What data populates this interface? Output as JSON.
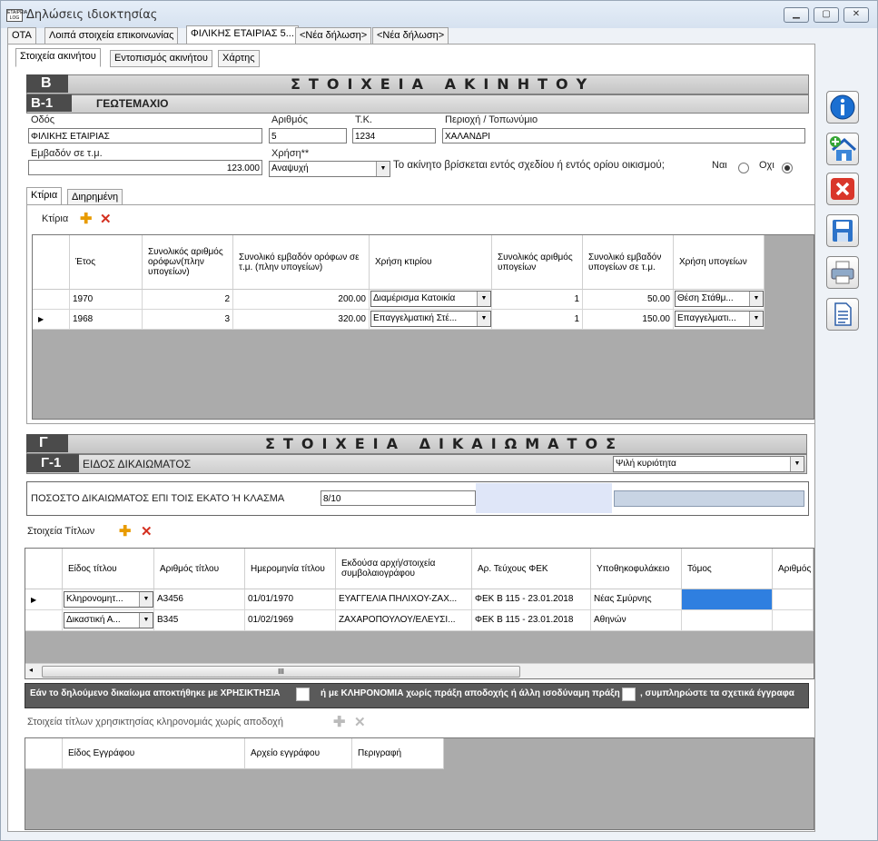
{
  "window": {
    "title": "Δηλώσεις ιδιοκτησίας",
    "app_icon": "ΕΤΑΙΡΕΙΑ LOG"
  },
  "main_tabs": [
    "ΟΤΑ",
    "Λοιπά στοιχεία επικοινωνίας",
    "ΦΙΛΙΚΗΣ ΕΤΑΙΡΙΑΣ 5...",
    "<Νέα δήλωση>",
    "<Νέα δήλωση>"
  ],
  "sub_tabs": [
    "Στοιχεία ακινήτου",
    "Εντοπισμός ακινήτου",
    "Χάρτης"
  ],
  "section_b": {
    "letter": "Β",
    "title": "ΣΤΟΙΧΕΙΑ ΑΚΙΝΗΤΟΥ",
    "sub_code": "Β-1",
    "sub_title": "ΓΕΩΤΕΜΑΧΙΟ",
    "street_label": "Οδός",
    "street_value": "ΦΙΛΙΚΗΣ ΕΤΑΙΡΙΑΣ",
    "number_label": "Αριθμός",
    "number_value": "5",
    "zip_label": "Τ.Κ.",
    "zip_value": "1234",
    "area_label": "Περιοχή / Τοπωνύμιο",
    "area_value": "ΧΑΛΑΝΔΡΙ",
    "sqm_label": "Εμβαδόν σε τ.μ.",
    "sqm_value": "123.000",
    "use_label": "Χρήση**",
    "use_value": "Αναψυχή",
    "question": "Το ακίνητο βρίσκεται εντός σχεδίου ή εντός ορίου οικισμού;",
    "yes": "Ναι",
    "no": "Οχι"
  },
  "building_tabs": [
    "Κτίρια",
    "Διηρημένη"
  ],
  "buildings": {
    "toolbar_label": "Κτίρια",
    "headers": [
      "Έτος",
      "Συνολικός αριθμός ορόφων(πλην υπογείων)",
      "Συνολικό εμβαδόν ορόφων σε τ.μ. (πλην υπογείων)",
      "Χρήση κτιρίου",
      "Συνολικός αριθμός υπογείων",
      "Συνολικό εμβαδόν υπογείων σε τ.μ.",
      "Χρήση υπογείων"
    ],
    "rows": [
      [
        "1970",
        "2",
        "200.00",
        "Διαμέρισμα Κατοικία",
        "1",
        "50.00",
        "Θέση Στάθμ..."
      ],
      [
        "1968",
        "3",
        "320.00",
        "Επαγγελματική Στέ...",
        "1",
        "150.00",
        "Επαγγελματι..."
      ]
    ]
  },
  "section_g": {
    "letter": "Γ",
    "title": "ΣΤΟΙΧΕΙΑ ΔΙΚΑΙΩΜΑΤΟΣ",
    "sub_code": "Γ-1",
    "sub_title": "ΕΙΔΟΣ ΔΙΚΑΙΩΜΑΤΟΣ",
    "right_type": "Ψιλή κυριότητα",
    "percent_label": "ΠΟΣΟΣΤΟ ΔΙΚΑΙΩΜΑΤΟΣ ΕΠΙ ΤΟΙΣ ΕΚΑΤΟ Ή ΚΛΑΣΜΑ",
    "percent_value": "8/10"
  },
  "titles": {
    "toolbar_label": "Στοιχεία Τίτλων",
    "headers": [
      "Είδος τίτλου",
      "Αριθμός τίτλου",
      "Ημερομηνία τίτλου",
      "Εκδούσα αρχή/στοιχεία συμβολαιογράφου",
      "Αρ. Τεύχους ΦΕΚ",
      "Υποθηκοφυλάκειο",
      "Τόμος",
      "Αριθμός"
    ],
    "rows": [
      [
        "Κληρονομητ...",
        "Α3456",
        "01/01/1970",
        "ΕΥΑΓΓΕΛΙΑ ΠΗΛΙΧΟΥ-ΖΑΧ...",
        "ΦΕΚ Β 115 - 23.01.2018",
        "Νέας Σμύρνης",
        "",
        ""
      ],
      [
        "Δικαστική Α...",
        "Β345",
        "01/02/1969",
        "ΖΑΧΑΡΟΠΟΥΛΟΥ/ΕΛΕΥΣΙ...",
        "ΦΕΚ Β 115 - 23.01.2018",
        "Αθηνών",
        "",
        ""
      ]
    ],
    "scroll_grip": "III"
  },
  "notice": {
    "part1": "Εάν το δηλούμενο δικαίωμα  αποκτήθηκε με ΧΡΗΣΙΚΤΗΣΙΑ",
    "part2": "ή με ΚΛΗΡΟΝΟΜΙΑ χωρίς πράξη αποδοχής ή άλλη ισοδύναμη πράξη",
    "part3": ",  συμπληρώστε τα σχετικά έγγραφα"
  },
  "usucaption": {
    "toolbar_label": "Στοιχεία τίτλων χρησικτησίας κληρονομιάς χωρίς αποδοχή",
    "headers": [
      "Είδος Εγγράφου",
      "Αρχείο εγγράφου",
      "Περιγραφή"
    ]
  },
  "side_icons": [
    "info-icon",
    "add-property-icon",
    "delete-icon",
    "save-icon",
    "print-icon",
    "document-icon"
  ]
}
